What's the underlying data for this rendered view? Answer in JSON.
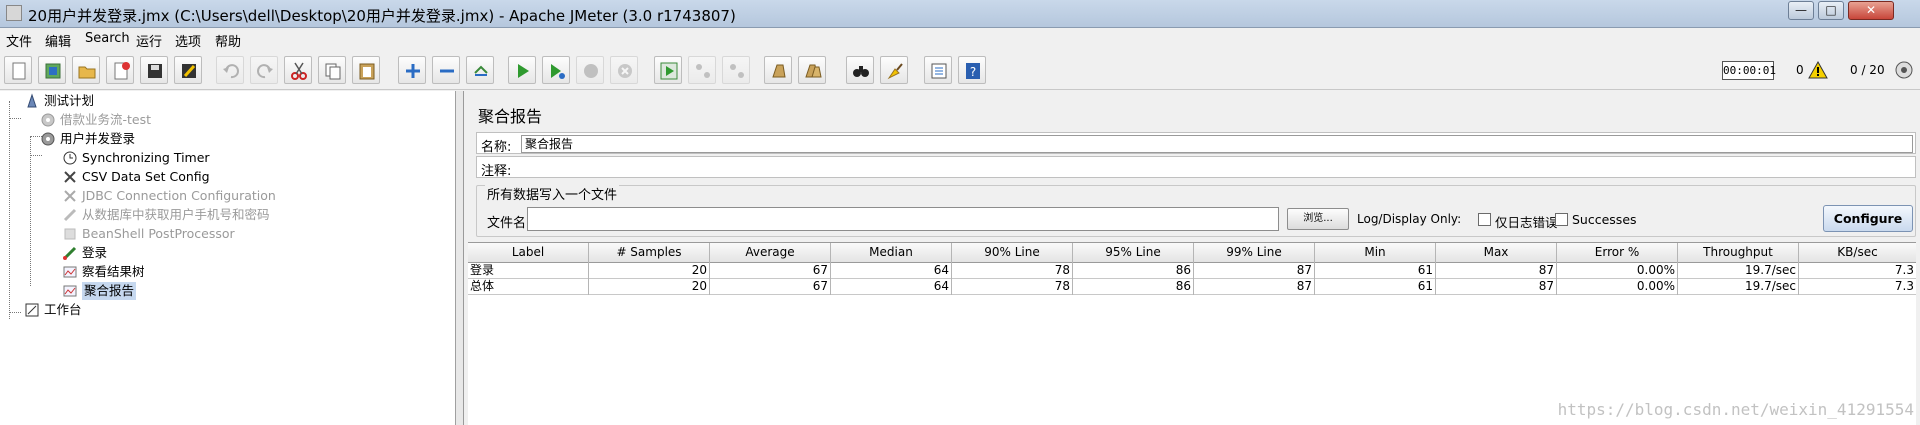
{
  "window": {
    "title": "20用户并发登录.jmx (C:\\Users\\dell\\Desktop\\20用户并发登录.jmx) - Apache JMeter (3.0 r1743807)",
    "minimize_glyph": "—",
    "maximize_glyph": "□",
    "close_glyph": "✕"
  },
  "menu": [
    "文件",
    "编辑",
    "Search",
    "运行",
    "选项",
    "帮助"
  ],
  "toolbar": {
    "timer": "00:00:01",
    "warning_count": "0",
    "threads": "0 / 20"
  },
  "tree": {
    "nodes": [
      {
        "label": "测试计划",
        "icon": "test-plan-icon"
      },
      {
        "label": "借款业务流-test",
        "icon": "thread-group-icon"
      },
      {
        "label": "用户并发登录",
        "icon": "thread-group-icon"
      },
      {
        "label": "Synchronizing Timer",
        "icon": "timer-icon"
      },
      {
        "label": "CSV Data Set Config",
        "icon": "config-icon"
      },
      {
        "label": "JDBC Connection Configuration",
        "icon": "config-icon"
      },
      {
        "label": "从数据库中获取用户手机号和密码",
        "icon": "sampler-icon"
      },
      {
        "label": "BeanShell PostProcessor",
        "icon": "postprocessor-icon"
      },
      {
        "label": "登录",
        "icon": "sampler-icon"
      },
      {
        "label": "察看结果树",
        "icon": "listener-icon"
      },
      {
        "label": "聚合报告",
        "icon": "listener-icon"
      },
      {
        "label": "工作台",
        "icon": "workbench-icon"
      }
    ]
  },
  "panel": {
    "title": "聚合报告",
    "name_label": "名称:",
    "name_value": "聚合报告",
    "comment_label": "注释:",
    "comment_value": "",
    "file_group_title": "所有数据写入一个文件",
    "file_label": "文件名",
    "file_value": "",
    "browse_label": "浏览...",
    "log_display_label": "Log/Display Only:",
    "errors_only_label": "仅日志错误",
    "successes_label": "Successes",
    "configure_label": "Configure"
  },
  "table": {
    "columns": [
      "Label",
      "# Samples",
      "Average",
      "Median",
      "90% Line",
      "95% Line",
      "99% Line",
      "Min",
      "Max",
      "Error %",
      "Throughput",
      "KB/sec"
    ],
    "rows": [
      [
        "登录",
        "20",
        "67",
        "64",
        "78",
        "86",
        "87",
        "61",
        "87",
        "0.00%",
        "19.7/sec",
        "7.3"
      ],
      [
        "总体",
        "20",
        "67",
        "64",
        "78",
        "86",
        "87",
        "61",
        "87",
        "0.00%",
        "19.7/sec",
        "7.3"
      ]
    ]
  },
  "watermark": "https://blog.csdn.net/weixin_41291554"
}
